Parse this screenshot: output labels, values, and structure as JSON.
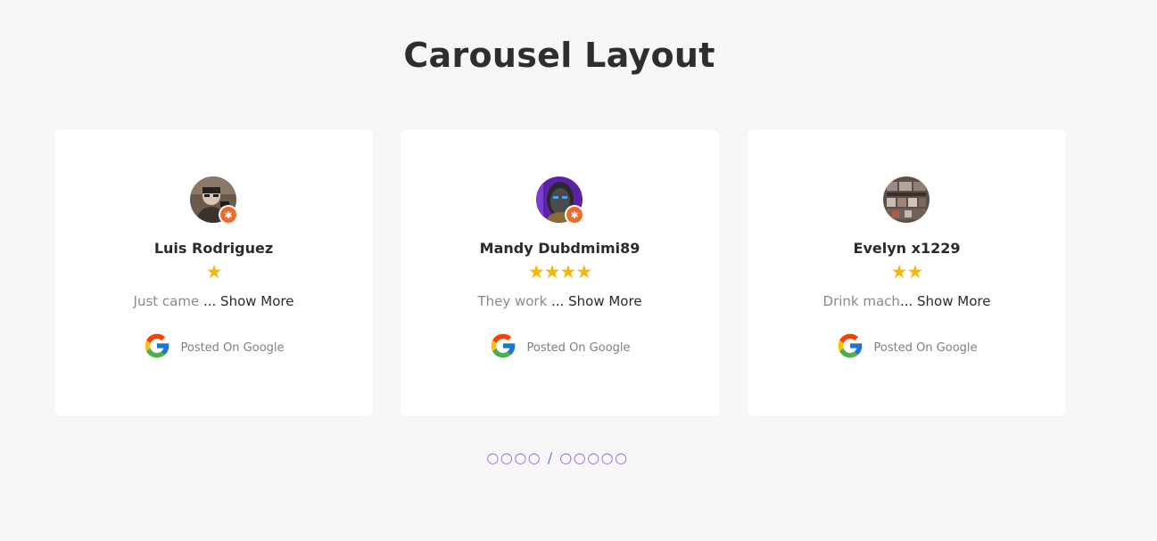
{
  "page": {
    "title": "Carousel Layout"
  },
  "reviews": [
    {
      "name": "Luis Rodriguez",
      "stars": "★",
      "rating": 1,
      "snippet": "Just came",
      "ellipsis": " ...",
      "show_more": " Show More",
      "source": "Posted On Google",
      "has_badge": true
    },
    {
      "name": "Mandy Dubdmimi89",
      "stars": "★★★★",
      "rating": 4,
      "snippet": "They work",
      "ellipsis": " ...",
      "show_more": " Show More",
      "source": "Posted On Google",
      "has_badge": true
    },
    {
      "name": "Evelyn x1229",
      "stars": "★★",
      "rating": 2,
      "snippet": "Drink mach",
      "ellipsis": "...",
      "show_more": " Show More",
      "source": "Posted On Google",
      "has_badge": false
    }
  ],
  "pagination": {
    "text": "○○○○ / ○○○○○"
  },
  "colors": {
    "background": "#f7f7f7",
    "card": "#ffffff",
    "star": "#f5b70a",
    "pagination": "#9e63dc",
    "badge": "#ef6b2b"
  }
}
